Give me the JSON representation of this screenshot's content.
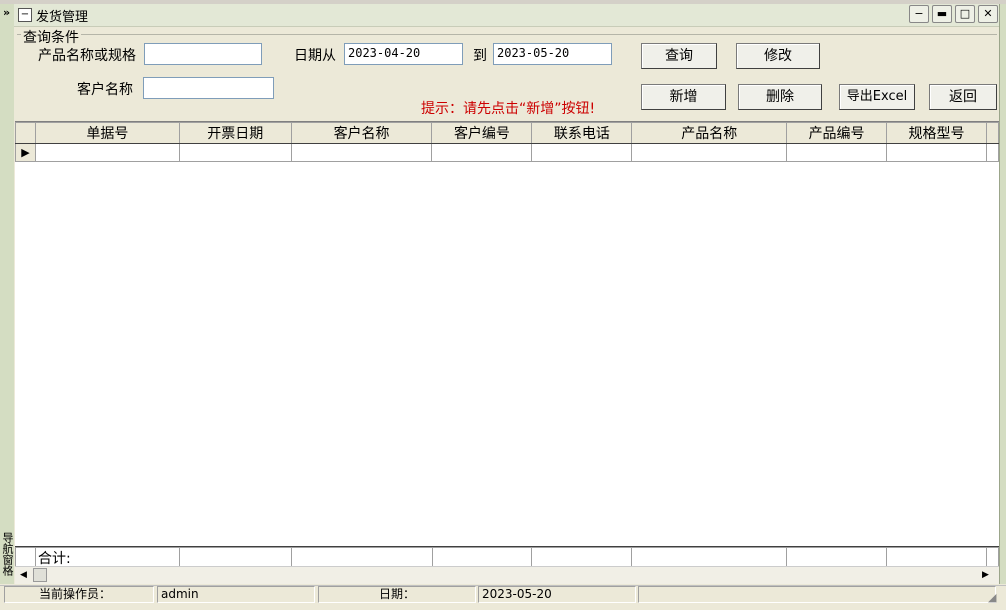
{
  "navpane": {
    "chevron": "»",
    "vertical_label": "导航窗格"
  },
  "window": {
    "title": "发货管理",
    "minimize": "▬",
    "restore": "□",
    "close": "✕",
    "sys": "−"
  },
  "query": {
    "group_label": "查询条件",
    "product_label": "产品名称或规格",
    "product_value": "",
    "date_from_label": "日期从",
    "date_from": "2023-04-20",
    "to_label": "到",
    "date_to": "2023-05-20",
    "customer_label": "客户名称",
    "customer_value": ""
  },
  "buttons": {
    "query": "查询",
    "modify": "修改",
    "add": "新增",
    "delete": "删除",
    "export": "导出Excel",
    "back": "返回"
  },
  "hint": "提示：请先点击“新增”按钮!",
  "grid": {
    "columns": [
      "单据号",
      "开票日期",
      "客户名称",
      "客户编号",
      "联系电话",
      "产品名称",
      "产品编号",
      "规格型号"
    ],
    "row_marker": "▶",
    "total_label": "合计:"
  },
  "status": {
    "operator_label": "当前操作员：",
    "operator": "admin",
    "date_label": "日期：",
    "date": "2023-05-20"
  }
}
